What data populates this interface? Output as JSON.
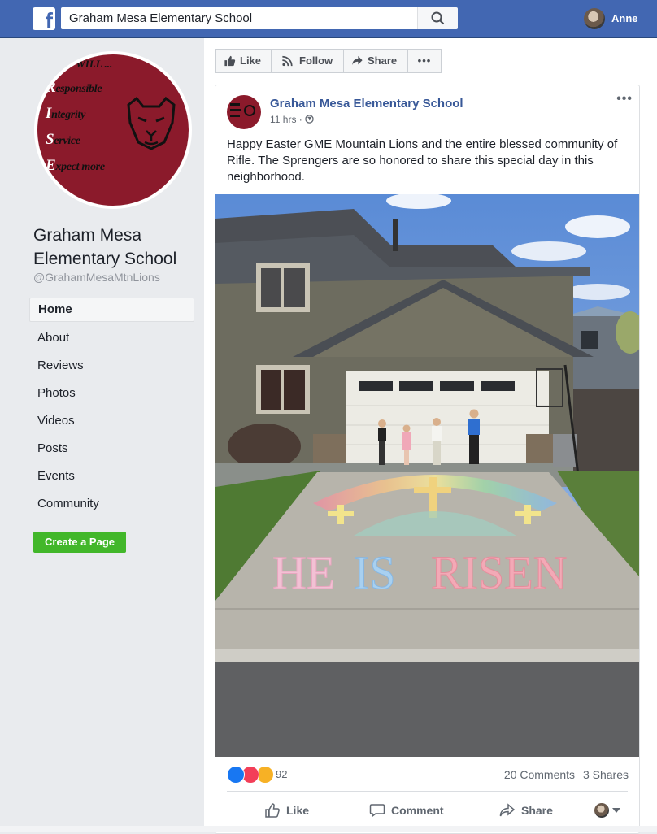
{
  "topbar": {
    "logo_letter": "f",
    "search_value": "Graham Mesa Elementary School",
    "user_name": "Anne"
  },
  "sidebar": {
    "profile_text": [
      "WE WILL ...",
      "Responsible",
      "Integrity",
      "Service",
      "Expect more"
    ],
    "page_name": "Graham Mesa Elementary School",
    "handle": "@GrahamMesaMtnLions",
    "nav": [
      {
        "label": "Home",
        "active": true
      },
      {
        "label": "About"
      },
      {
        "label": "Reviews"
      },
      {
        "label": "Photos"
      },
      {
        "label": "Videos"
      },
      {
        "label": "Posts"
      },
      {
        "label": "Events"
      },
      {
        "label": "Community"
      }
    ],
    "create_page_label": "Create a Page"
  },
  "actions": {
    "like": "Like",
    "follow": "Follow",
    "share": "Share",
    "more": "•••"
  },
  "post": {
    "author": "Graham Mesa Elementary School",
    "time": "11 hrs · ",
    "more": "•••",
    "text": "Happy Easter GME Mountain Lions and the entire blessed community of Rifle. The Sprengers are so honored to share this special day in this neighborhood.",
    "photo_caption_art": "He Is Risen",
    "reaction_count": "92",
    "comments": "20 Comments",
    "shares": "3 Shares",
    "buttons": {
      "like": "Like",
      "comment": "Comment",
      "share": "Share"
    }
  },
  "colors": {
    "brand_blue": "#4267b2",
    "link_blue": "#385898",
    "green": "#42b72a",
    "school_maroon": "#8b1a2b"
  }
}
